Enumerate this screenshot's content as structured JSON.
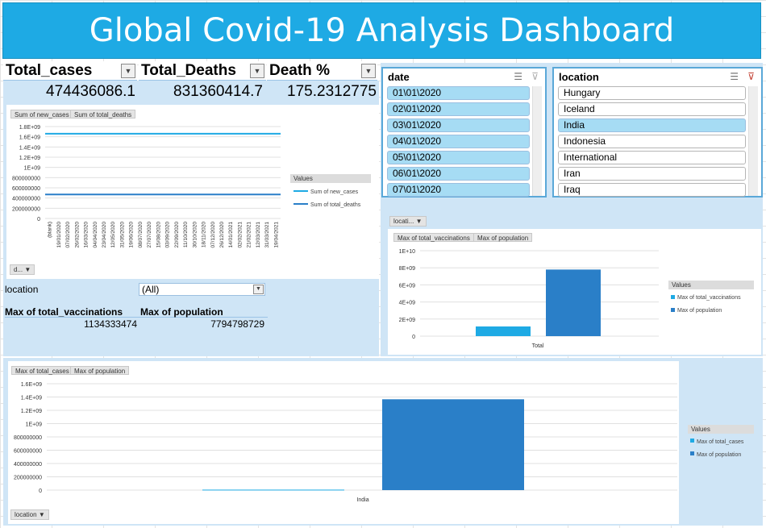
{
  "title": "Global Covid-19 Analysis Dashboard",
  "kpi": {
    "headers": [
      "Total_cases",
      "Total_Deaths",
      "Death %"
    ],
    "values": [
      "474436086.1",
      "831360414.7",
      "175.2312775"
    ]
  },
  "slicers": {
    "date": {
      "title": "date",
      "items": [
        "01\\01\\2020",
        "02\\01\\2020",
        "03\\01\\2020",
        "04\\01\\2020",
        "05\\01\\2020",
        "06\\01\\2020",
        "07\\01\\2020"
      ]
    },
    "location": {
      "title": "location",
      "items": [
        "Hungary",
        "Iceland",
        "India",
        "Indonesia",
        "International",
        "Iran",
        "Iraq"
      ],
      "selected_index": 2
    }
  },
  "line_chart": {
    "tags": [
      "Sum of new_cases",
      "Sum of total_deaths"
    ],
    "field_button": "d...",
    "legend_title": "Values",
    "colors": {
      "new_cases": "#1eaae4",
      "total_deaths": "#2a7fc8"
    }
  },
  "pivot": {
    "filter_label": "location",
    "filter_value": "(All)",
    "headers": [
      "Max of total_vaccinations",
      "Max of population"
    ],
    "values": [
      "1134333474",
      "7794798729"
    ]
  },
  "bar_chart_total": {
    "field_button": "locati...",
    "tags": [
      "Max of total_vaccinations",
      "Max of population"
    ],
    "legend_title": "Values"
  },
  "bar_chart_india": {
    "tags": [
      "Max of total_cases",
      "Max of population"
    ],
    "field_button": "location",
    "legend_title": "Values"
  },
  "chart_data": [
    {
      "type": "line",
      "x": [
        "(blank)",
        "19/01/2020",
        "07/02/2020",
        "26/02/2020",
        "16/03/2020",
        "04/04/2020",
        "23/04/2020",
        "12/05/2020",
        "31/05/2020",
        "19/06/2020",
        "08/07/2020",
        "27/07/2020",
        "15/08/2020",
        "03/09/2020",
        "22/09/2020",
        "11/10/2020",
        "30/10/2020",
        "18/11/2020",
        "07/12/2020",
        "26/12/2020",
        "14/01/2021",
        "02/02/2021",
        "21/02/2021",
        "12/03/2021",
        "31/03/2021",
        "19/04/2021"
      ],
      "yticks": [
        "0",
        "200000000",
        "400000000",
        "600000000",
        "800000000",
        "1E+09",
        "1.2E+09",
        "1.4E+09",
        "1.6E+09",
        "1.8E+09"
      ],
      "ylim": [
        0,
        1800000000
      ],
      "series": [
        {
          "name": "Sum of new_cases",
          "value": 1660000000
        },
        {
          "name": "Sum of total_deaths",
          "value": 470000000
        }
      ],
      "legend": "right"
    },
    {
      "type": "bar",
      "categories": [
        "Total"
      ],
      "yticks": [
        "0",
        "2E+09",
        "4E+09",
        "6E+09",
        "8E+09",
        "1E+10"
      ],
      "ylim": [
        0,
        10000000000
      ],
      "series": [
        {
          "name": "Max of total_vaccinations",
          "values": [
            1134333474
          ]
        },
        {
          "name": "Max of population",
          "values": [
            7794798729
          ]
        }
      ],
      "legend": "right"
    },
    {
      "type": "bar",
      "categories": [
        "India"
      ],
      "yticks": [
        "0",
        "200000000",
        "400000000",
        "600000000",
        "800000000",
        "1E+09",
        "1.2E+09",
        "1.4E+09",
        "1.6E+09"
      ],
      "ylim": [
        0,
        1600000000
      ],
      "series": [
        {
          "name": "Max of total_cases",
          "values": [
            7000000
          ]
        },
        {
          "name": "Max of population",
          "values": [
            1366000000
          ]
        }
      ],
      "legend": "right"
    }
  ]
}
